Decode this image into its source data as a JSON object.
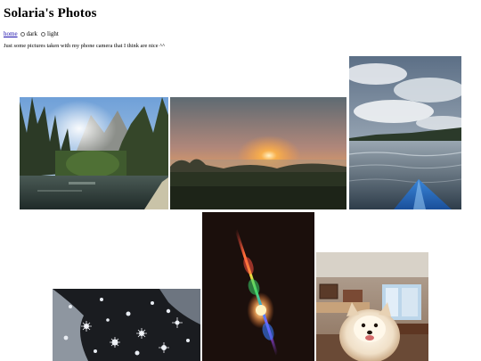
{
  "page": {
    "title": "Solaria's Photos",
    "tagline": "Just some pictures taken with my phone camera that I think are nice ^^"
  },
  "nav": {
    "home_label": "home",
    "theme_options": [
      {
        "label": "dark",
        "selected": false
      },
      {
        "label": "light",
        "selected": false
      }
    ]
  },
  "gallery": {
    "photos": [
      {
        "subject": "river with pine trees and sun flare through the forest"
      },
      {
        "subject": "sunrise over a misty field"
      },
      {
        "subject": "lake under a cloudy sky with the bow of a blue kayak"
      },
      {
        "subject": "snowflakes on dark fabric"
      },
      {
        "subject": "rainbow light streak against a dark background"
      },
      {
        "subject": "fluffy pomeranian dog in a living room"
      }
    ]
  },
  "colors": {
    "link": "#1a0dab",
    "background": "#ffffff"
  }
}
